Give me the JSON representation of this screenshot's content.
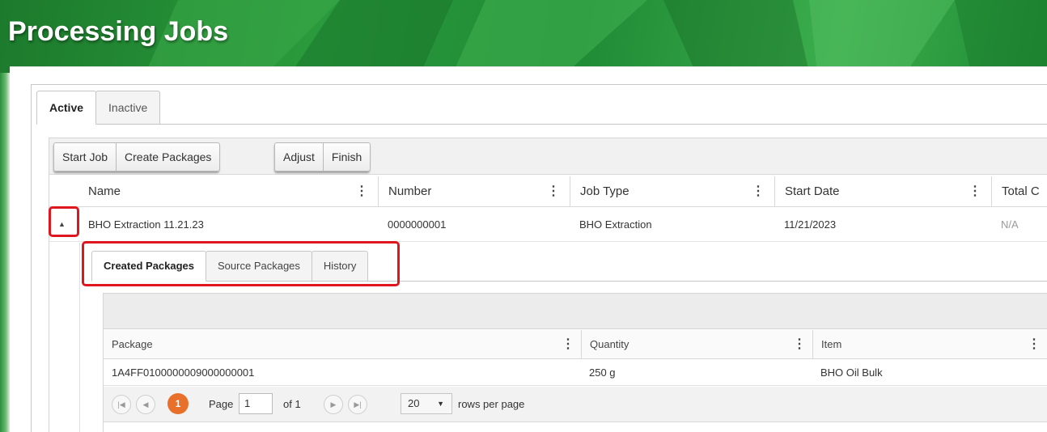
{
  "page": {
    "title": "Processing Jobs"
  },
  "colors": {
    "brand_green": "#2a9a3c",
    "highlight_red": "#e0161f",
    "pager_orange": "#e8702a"
  },
  "main_tabs": [
    {
      "label": "Active",
      "active": true
    },
    {
      "label": "Inactive",
      "active": false
    }
  ],
  "toolbar": {
    "group1": [
      "Start Job",
      "Create Packages"
    ],
    "group2": [
      "Adjust",
      "Finish"
    ]
  },
  "jobs_grid": {
    "columns": [
      "Name",
      "Number",
      "Job Type",
      "Start Date",
      "Total C"
    ],
    "rows": [
      {
        "name": "BHO Extraction 11.21.23",
        "number": "0000000001",
        "job_type": "BHO Extraction",
        "start_date": "11/21/2023",
        "total": "N/A"
      }
    ]
  },
  "detail_tabs": [
    {
      "label": "Created Packages",
      "active": true
    },
    {
      "label": "Source Packages",
      "active": false
    },
    {
      "label": "History",
      "active": false
    }
  ],
  "packages_grid": {
    "columns": [
      "Package",
      "Quantity",
      "Item"
    ],
    "rows": [
      {
        "package": "1A4FF0100000009000000001",
        "quantity": "250 g",
        "item": "BHO Oil Bulk"
      }
    ]
  },
  "pager": {
    "current_page": "1",
    "page_label": "Page",
    "page_input": "1",
    "of_label": "of 1",
    "rows_per_page": "20",
    "rows_label": "rows per page"
  },
  "icons": {
    "expand": "triangle-up-icon",
    "kebab": "kebab-menu-icon",
    "first": "first-page-icon",
    "prev": "prev-page-icon",
    "next": "next-page-icon",
    "last": "last-page-icon"
  }
}
